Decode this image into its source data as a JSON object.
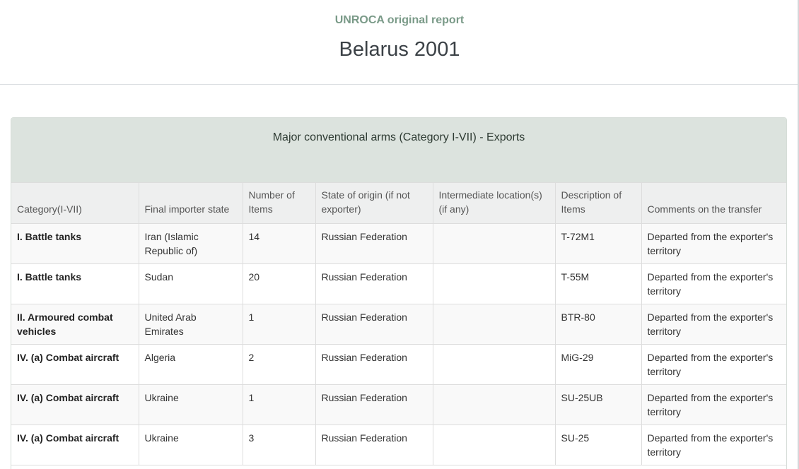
{
  "header": {
    "subtitle": "UNROCA original report",
    "title": "Belarus 2001"
  },
  "panel": {
    "heading": "Major conventional arms (Category I-VII) - Exports"
  },
  "table": {
    "columns": [
      "Category(I-VII)",
      "Final importer state",
      "Number of Items",
      "State of origin (if not exporter)",
      "Intermediate location(s) (if any)",
      "Description of Items",
      "Comments on the transfer"
    ],
    "rows": [
      [
        "I. Battle tanks",
        "Iran (Islamic Republic of)",
        "14",
        "Russian Federation",
        "",
        "T-72M1",
        "Departed from the exporter's territory"
      ],
      [
        "I. Battle tanks",
        "Sudan",
        "20",
        "Russian Federation",
        "",
        "T-55M",
        "Departed from the exporter's territory"
      ],
      [
        "II. Armoured combat vehicles",
        "United Arab Emirates",
        "1",
        "Russian Federation",
        "",
        "BTR-80",
        "Departed from the exporter's territory"
      ],
      [
        "IV. (a) Combat aircraft",
        "Algeria",
        "2",
        "Russian Federation",
        "",
        "MiG-29",
        "Departed from the exporter's territory"
      ],
      [
        "IV. (a) Combat aircraft",
        "Ukraine",
        "1",
        "Russian Federation",
        "",
        "SU-25UB",
        "Departed from the exporter's territory"
      ],
      [
        "IV. (a) Combat aircraft",
        "Ukraine",
        "3",
        "Russian Federation",
        "",
        "SU-25",
        "Departed from the exporter's territory"
      ]
    ]
  }
}
